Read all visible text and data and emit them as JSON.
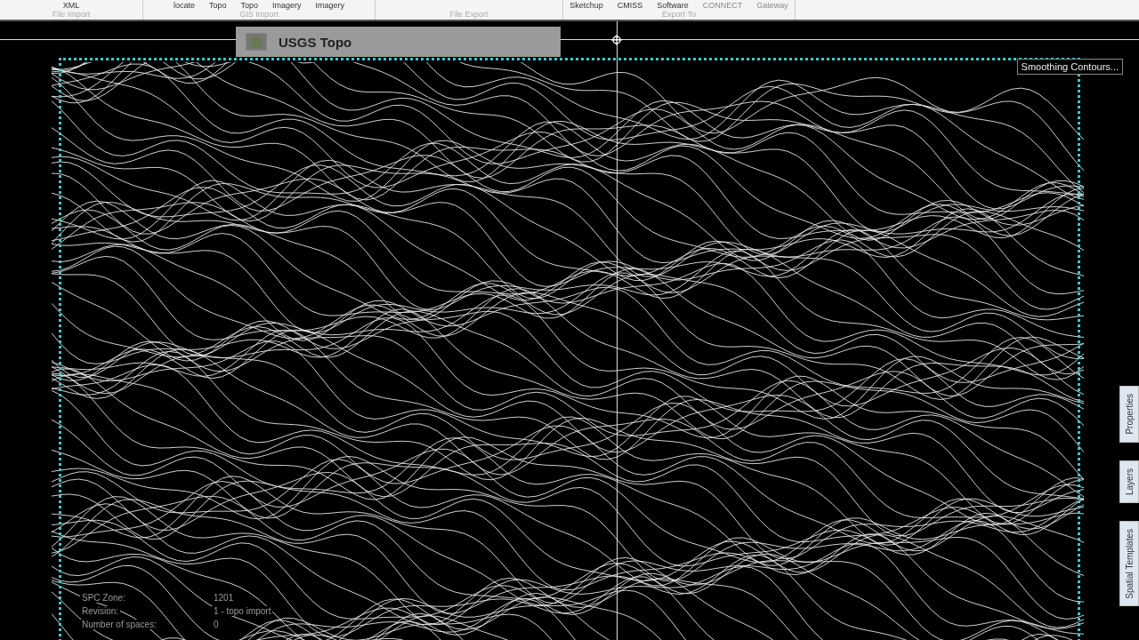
{
  "ribbon": {
    "groups": [
      {
        "label": "File Import",
        "buttons": [
          {
            "label": "XML",
            "disabled": false
          }
        ]
      },
      {
        "label": "GIS Import",
        "buttons": [
          {
            "label": "locate",
            "disabled": false
          },
          {
            "label": "Topo",
            "disabled": false
          },
          {
            "label": "Topo",
            "disabled": false
          },
          {
            "label": "Imagery",
            "disabled": false
          },
          {
            "label": "Imagery",
            "disabled": false
          }
        ]
      },
      {
        "label": "File Export"
      },
      {
        "label": "Export To",
        "buttons": [
          {
            "label": "Sketchup",
            "disabled": false
          },
          {
            "label": "CMISS",
            "disabled": false
          },
          {
            "label": "Software",
            "disabled": false
          },
          {
            "label": "CONNECT",
            "disabled": true
          },
          {
            "label": "Gateway",
            "disabled": true
          }
        ]
      }
    ]
  },
  "overlay_panel": {
    "title": "USGS Topo"
  },
  "tooltip": "Smoothing Contours...",
  "info": [
    {
      "label": "SPC Zone:",
      "value": "1201"
    },
    {
      "label": "Revision:",
      "value": "1 - topo import"
    },
    {
      "label": "Number of spaces:",
      "value": "0"
    }
  ],
  "side_tabs": [
    {
      "label": "Properties"
    },
    {
      "label": "Layers"
    },
    {
      "label": "Spatial Templates"
    }
  ]
}
